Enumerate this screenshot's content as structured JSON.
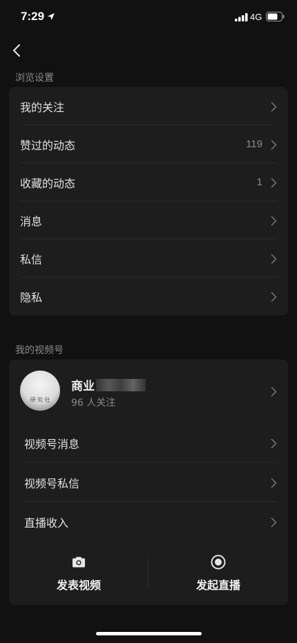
{
  "status_bar": {
    "time": "7:29",
    "network": "4G"
  },
  "nav": {
    "back_icon": "chevron-left-icon"
  },
  "browse_section": {
    "header": "浏览设置",
    "items": [
      {
        "label": "我的关注",
        "value": ""
      },
      {
        "label": "赞过的动态",
        "value": "119"
      },
      {
        "label": "收藏的动态",
        "value": "1"
      },
      {
        "label": "消息",
        "value": ""
      },
      {
        "label": "私信",
        "value": ""
      },
      {
        "label": "隐私",
        "value": ""
      }
    ]
  },
  "channels_section": {
    "header": "我的视频号",
    "profile": {
      "name": "商业",
      "followers": "96 人关注",
      "avatar_text": "研·究·社"
    },
    "items": [
      {
        "label": "视频号消息"
      },
      {
        "label": "视频号私信"
      },
      {
        "label": "直播收入"
      }
    ],
    "actions": [
      {
        "label": "发表视频",
        "icon": "camera-icon"
      },
      {
        "label": "发起直播",
        "icon": "live-record-icon"
      }
    ]
  },
  "colors": {
    "background": "#111111",
    "card": "#1d1d1d",
    "divider": "#2a2a2a",
    "secondary_text": "#8a8a8a"
  }
}
